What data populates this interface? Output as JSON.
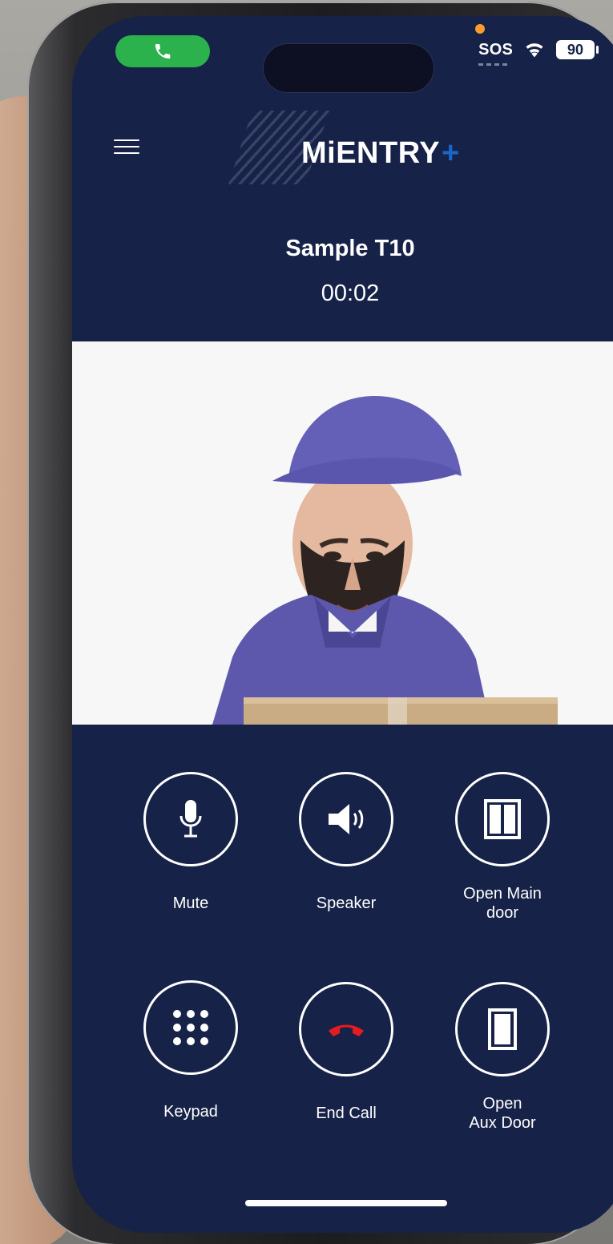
{
  "status": {
    "sos": "SOS",
    "battery": "90"
  },
  "app": {
    "logo_text": "MiENTRY",
    "logo_plus": "+"
  },
  "call": {
    "caller_name": "Sample T10",
    "timer": "00:02"
  },
  "actions": {
    "mute": "Mute",
    "speaker": "Speaker",
    "open_main_door": "Open Main\ndoor",
    "keypad": "Keypad",
    "end_call": "End Call",
    "open_aux_door": "Open\nAux Door"
  },
  "colors": {
    "background": "#162247",
    "video_bg": "#f7f7f7",
    "accent_blue": "#1a65c7",
    "end_call_red": "#e31b23",
    "active_call_green": "#2bb24c"
  },
  "icons": {
    "active_call": "phone-icon",
    "menu": "hamburger-menu-icon",
    "mute": "microphone-icon",
    "speaker": "speaker-icon",
    "main_door": "double-door-icon",
    "keypad": "keypad-icon",
    "end_call": "end-call-icon",
    "aux_door": "single-door-icon"
  }
}
